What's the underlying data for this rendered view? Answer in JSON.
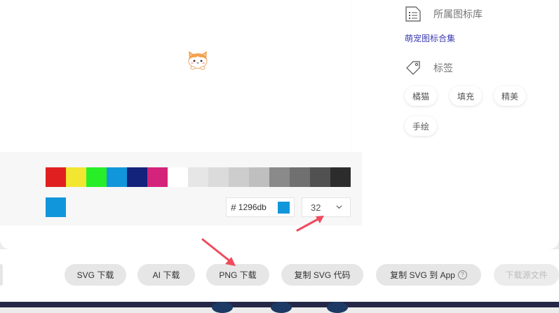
{
  "preview": {
    "icon": "cat-face-icon"
  },
  "palette": {
    "swatches": [
      "#e02020",
      "#f2e630",
      "#27ee27",
      "#1296db",
      "#13227a",
      "#d4237a",
      "#ffffff",
      "#e6e6e6",
      "#dbdbdb",
      "#cdcdcd",
      "#bfbfbf",
      "#8a8a8a",
      "#707070",
      "#515151",
      "#2c2c2c"
    ],
    "current_color": "#1296db"
  },
  "color_input": {
    "hash": "#",
    "value": "1296db"
  },
  "size_select": {
    "value": "32"
  },
  "sidebar": {
    "library_label": "所属图标库",
    "library_link": "萌宠图标合集",
    "tags_label": "标签",
    "tags": [
      "橘猫",
      "填充",
      "精美",
      "手绘"
    ]
  },
  "actions": {
    "svg_download": "SVG 下载",
    "ai_download": "AI 下载",
    "png_download": "PNG 下载",
    "copy_svg_code": "复制 SVG 代码",
    "copy_svg_to_app": "复制 SVG 到 App",
    "help_icon_text": "?",
    "download_source": "下载源文件"
  },
  "colors": {
    "accent": "#1296db",
    "link": "#3d3bb0",
    "annotation_arrow": "#ef4b5c",
    "footer": "#242746"
  }
}
